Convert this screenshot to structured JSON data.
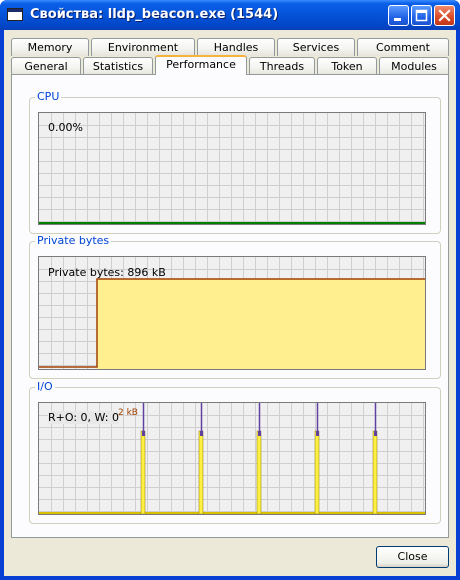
{
  "window": {
    "title": "Свойства: lldp_beacon.exe (1544)"
  },
  "tabs_row1": [
    "Memory",
    "Environment",
    "Handles",
    "Services",
    "Comment"
  ],
  "tabs_row2": [
    "General",
    "Statistics",
    "Performance",
    "Threads",
    "Token",
    "Modules"
  ],
  "active_tab": "Performance",
  "cpu": {
    "label": "CPU",
    "value_text": "0.00%",
    "series": [
      0,
      0,
      0,
      0,
      0,
      0,
      0,
      0,
      0,
      0,
      0,
      0,
      0,
      0,
      0,
      0,
      0,
      0,
      0,
      0
    ],
    "line_color": "#008000"
  },
  "private_bytes": {
    "label": "Private bytes",
    "value_text": "Private bytes: 896 kB",
    "step_fraction": 0.15,
    "level_fraction": 0.8,
    "fill_color": "#ffef8f",
    "line_color": "#a04000"
  },
  "io": {
    "label": "I/O",
    "value_text": "R+O: 0, W: 0",
    "max_label": "2 kB",
    "spike_positions": [
      0.27,
      0.42,
      0.57,
      0.72,
      0.87
    ],
    "fill_color": "#ffef3f",
    "line_color": "#6040a0"
  },
  "buttons": {
    "close": "Close"
  }
}
